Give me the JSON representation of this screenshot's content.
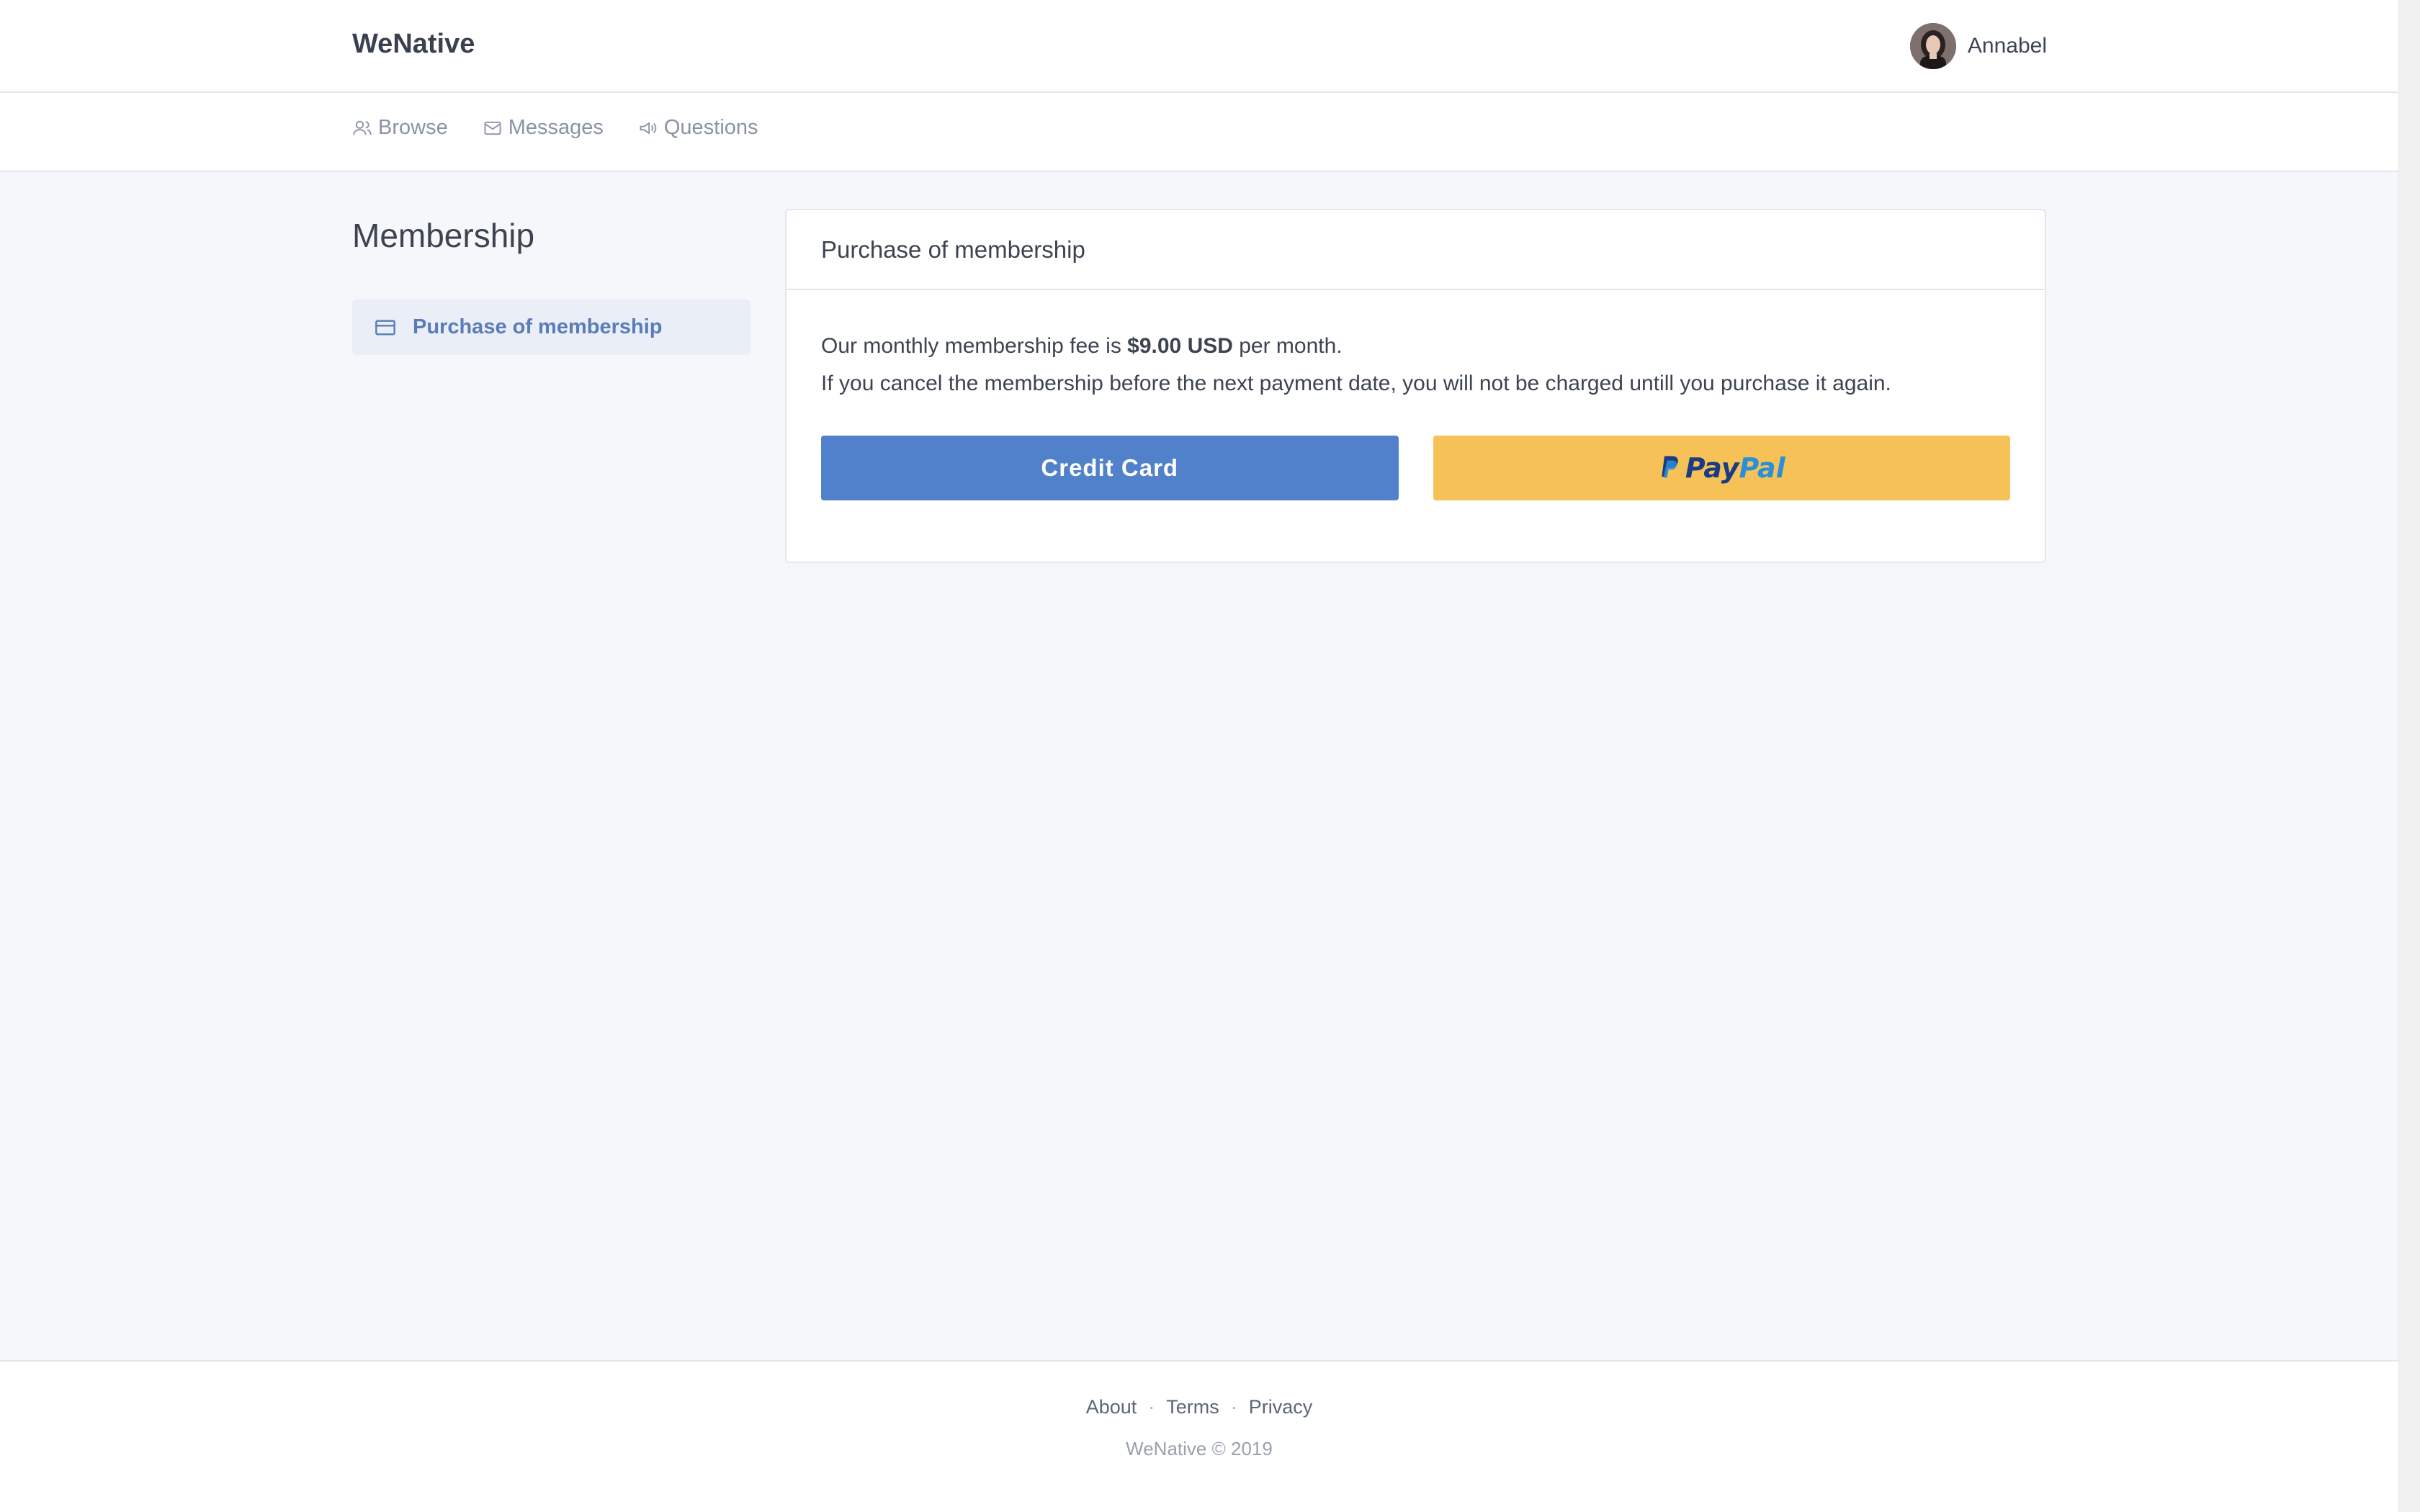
{
  "header": {
    "brand": "WeNative",
    "user": {
      "name": "Annabel"
    }
  },
  "nav": {
    "items": [
      {
        "label": "Browse",
        "icon": "users-icon"
      },
      {
        "label": "Messages",
        "icon": "envelope-icon"
      },
      {
        "label": "Questions",
        "icon": "megaphone-icon"
      }
    ]
  },
  "sidebar": {
    "title": "Membership",
    "items": [
      {
        "label": "Purchase of membership",
        "icon": "credit-card-icon",
        "active": true
      }
    ]
  },
  "card": {
    "title": "Purchase of membership",
    "fee_prefix": "Our monthly membership fee is ",
    "fee_amount": "$9.00 USD",
    "fee_suffix": " per month.",
    "cancel_note": "If you cancel the membership before the next payment date, you will not be charged untill you purchase it again.",
    "credit_card_label": "Credit Card",
    "paypal_label_pay": "Pay",
    "paypal_label_pal": "Pal"
  },
  "footer": {
    "links": [
      "About",
      "Terms",
      "Privacy"
    ],
    "separator": "·",
    "copyright": "WeNative © 2019"
  },
  "colors": {
    "credit_card_button": "#5181ca",
    "paypal_button": "#f6c257",
    "sidebar_active_bg": "#e9eef7",
    "sidebar_active_text": "#5a7cb8",
    "page_bg": "#f5f7fb"
  }
}
